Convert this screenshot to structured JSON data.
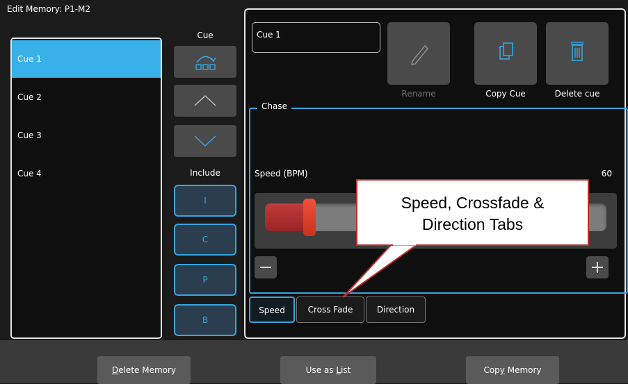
{
  "header": {
    "title": "Edit Memory: P1-M2"
  },
  "cues": {
    "items": [
      {
        "label": "Cue 1",
        "selected": true
      },
      {
        "label": "Cue 2",
        "selected": false
      },
      {
        "label": "Cue 3",
        "selected": false
      },
      {
        "label": "Cue 4",
        "selected": false
      }
    ]
  },
  "middle": {
    "cue_label": "Cue",
    "include_label": "Include",
    "icons": {
      "cue_icon": "cue-reorder-icon",
      "up_icon": "chevron-up-icon",
      "down_icon": "chevron-down-icon"
    },
    "include_buttons": [
      "I",
      "C",
      "P",
      "B"
    ]
  },
  "right": {
    "name_value": "Cue 1",
    "rename_label": "Rename",
    "copy_label": "Copy Cue",
    "delete_label": "Delete cue",
    "icons": {
      "rename": "pencil-icon",
      "copy": "copy-icon",
      "delete": "trash-icon"
    },
    "chase_label": "Chase",
    "speed_label": "Speed (BPM)",
    "speed_value": "60",
    "slider_level_fraction": 0.13,
    "tabs": [
      "Speed",
      "Cross Fade",
      "Direction"
    ],
    "active_tab": "Speed"
  },
  "bottom": {
    "delete_memory": {
      "prefix": "",
      "underline": "D",
      "rest": "elete Memory"
    },
    "use_as_list": {
      "prefix": "Use as ",
      "underline": "L",
      "rest": "ist"
    },
    "copy_memory": {
      "prefix": "Cop",
      "underline": "y",
      "rest": " Memory"
    }
  },
  "callout": {
    "line1": "Speed, Crossfade &",
    "line2": "Direction Tabs"
  },
  "colors": {
    "accent": "#34a6e0",
    "selected": "#38b0e8",
    "slider_red": "#c8321f",
    "callout_border": "#bb2c2c"
  }
}
